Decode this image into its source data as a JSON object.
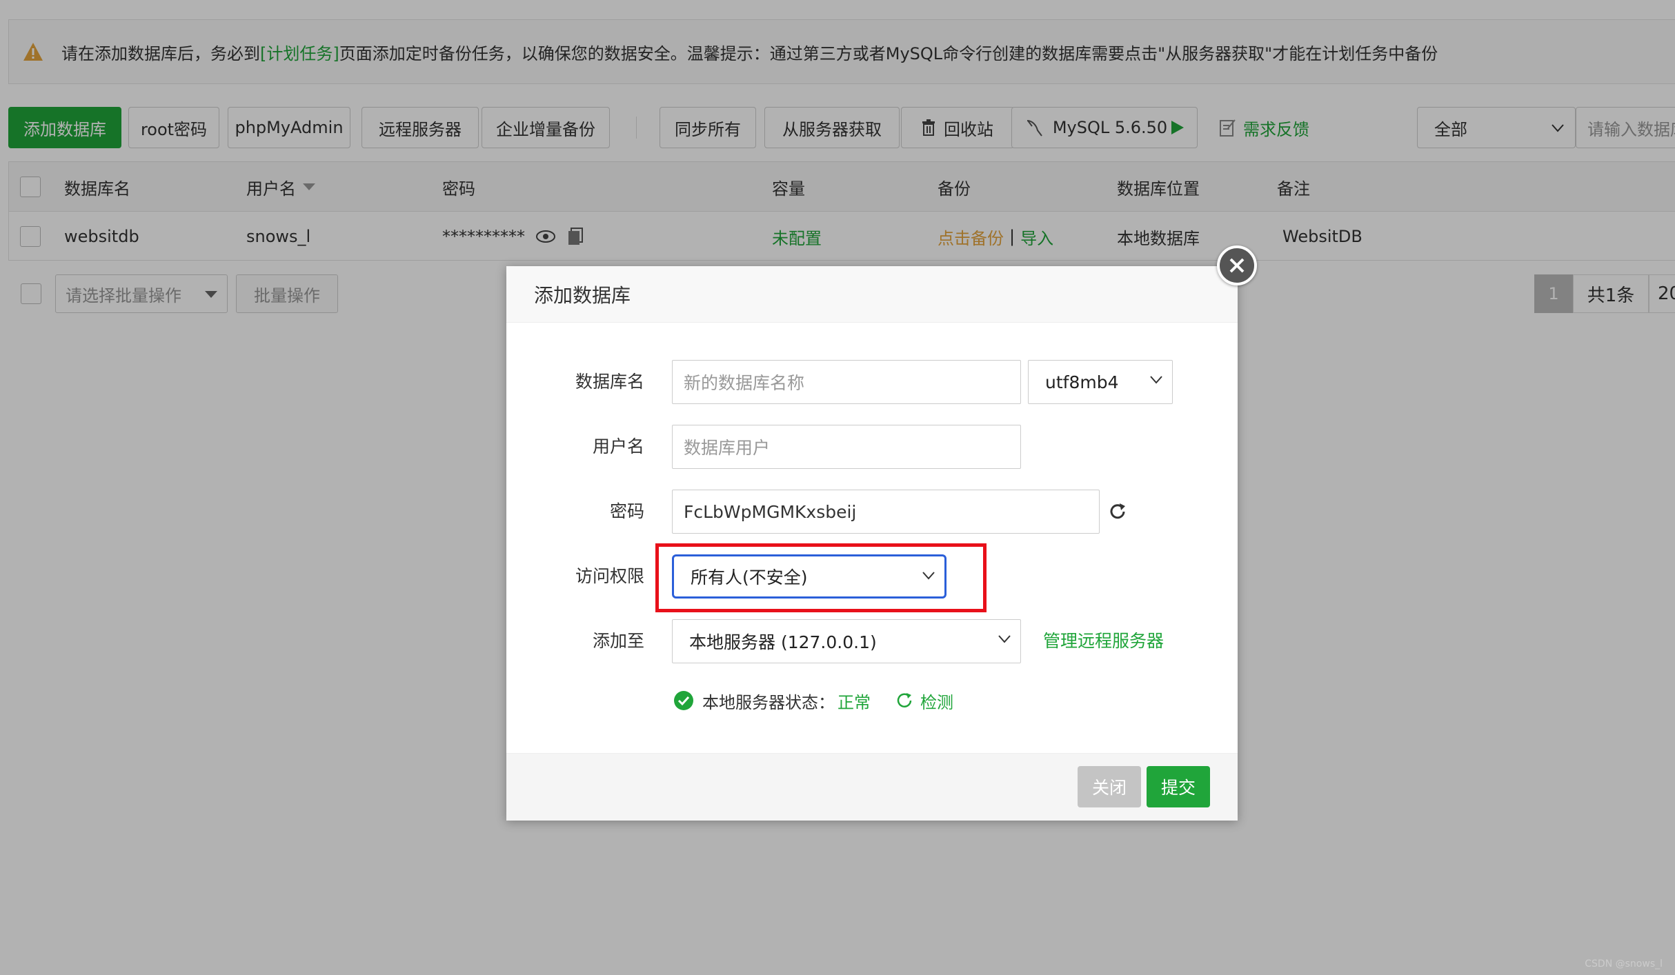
{
  "notice": {
    "prefix": "请在添加数据库后，务必到",
    "link": "[计划任务]",
    "suffix": "页面添加定时备份任务，以确保您的数据安全。温馨提示：通过第三方或者MySQL命令行创建的数据库需要点击\"从服务器获取\"才能在计划任务中备份"
  },
  "toolbar": {
    "add_db": "添加数据库",
    "root_pwd": "root密码",
    "phpmyadmin": "phpMyAdmin",
    "remote_server": "远程服务器",
    "enterprise_backup": "企业增量备份",
    "sync_all": "同步所有",
    "fetch_from_server": "从服务器获取",
    "recycle_bin": "回收站",
    "mysql_version": "MySQL 5.6.50",
    "feedback": "需求反馈",
    "filter_value": "全部",
    "search_placeholder": "请输入数据库名"
  },
  "table": {
    "headers": {
      "name": "数据库名",
      "user": "用户名",
      "password": "密码",
      "capacity": "容量",
      "backup": "备份",
      "location": "数据库位置",
      "remark": "备注"
    },
    "row": {
      "name": "websitdb",
      "user": "snows_l",
      "password": "**********",
      "capacity": "未配置",
      "backup_click": "点击备份",
      "backup_sep": "|",
      "backup_import": "导入",
      "location": "本地数据库",
      "remark": "WebsitDB"
    }
  },
  "batch": {
    "select_placeholder": "请选择批量操作",
    "button": "批量操作"
  },
  "pager": {
    "current": "1",
    "total": "共1条",
    "size": "20"
  },
  "modal": {
    "title": "添加数据库",
    "labels": {
      "db_name": "数据库名",
      "username": "用户名",
      "password": "密码",
      "access": "访问权限",
      "add_to": "添加至"
    },
    "db_name_placeholder": "新的数据库名称",
    "charset": "utf8mb4",
    "username_placeholder": "数据库用户",
    "password_value": "FcLbWpMGMKxsbeij",
    "access_value": "所有人(不安全)",
    "add_to_value": "本地服务器 (127.0.0.1)",
    "manage_remote": "管理远程服务器",
    "status_label": "本地服务器状态：",
    "status_value": "正常",
    "check": "检测",
    "close_btn": "关闭",
    "submit_btn": "提交"
  },
  "colors": {
    "brand_green": "#20a53a",
    "highlight_red": "#e8101a",
    "focus_blue": "#2b5fd9",
    "warn_orange": "#e4a43d"
  },
  "watermark": "CSDN @snows_l"
}
